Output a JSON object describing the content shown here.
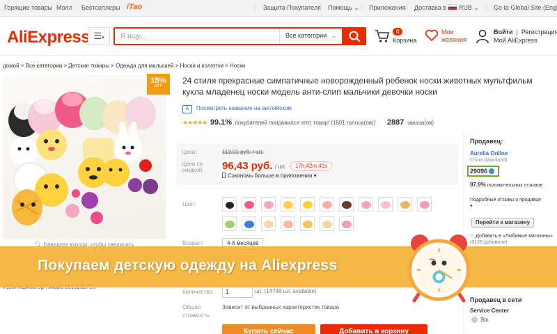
{
  "topbar": {
    "hot_deals": "Горящие товары",
    "mall": "Молл",
    "bestsellers": "Бестселлеры",
    "taobao": "iTao",
    "buyer_protection": "Защита Покупателя",
    "help": "Помощь",
    "apps": "Приложения",
    "ship_to": "Доставка в",
    "currency": "RUB",
    "global_site": "Go to Global Site (English)"
  },
  "header": {
    "logo": "AliExpress",
    "search_placeholder": "Я ищу...",
    "search_category": "Все категории",
    "cart_count": "0",
    "cart_label": "Корзина",
    "wishlist_label_1": "Мои",
    "wishlist_label_2": "желания",
    "login": "Войти",
    "register": "Регистрация",
    "my_aliexpress": "Мой AliExpress"
  },
  "breadcrumb": [
    "домой",
    "Все категории",
    "Детские товары",
    "Одежда для малышей",
    "Носки и колготки",
    "Носки"
  ],
  "product": {
    "discount_pct": "15%",
    "discount_off": "OFF",
    "zoom_hint": "Наведите курсор, чтобы увеличить",
    "title": "24 стиля прекрасные симпатичные новорожденный ребенок носки животных мультфильм кукла младенец носки модель анти-слип мальчики девочки носки",
    "translate_link": "Посмотреть название на английском",
    "rating_pct": "99.1%",
    "rating_text": "покупателей понравился этот товар! (1501 голоса(ов))",
    "orders_count": "2887",
    "orders_label": "заказа(ов)",
    "price_label": "Цена:",
    "old_price": "113,01 руб. / шт.",
    "discount_price_label_1": "Цена со",
    "discount_price_label_2": "скидкой:",
    "new_price": "96,43 руб.",
    "price_unit": "/ шт.",
    "timer": "17h:42m:41s",
    "app_save": "Сэкономь больше в приложении",
    "color_label": "Цвет:",
    "age_label": "Возраст",
    "age_value": "4-6 месяцев",
    "product_id": "Идентификатор товара 2013202735",
    "qty_label": "Количество:",
    "qty_value": "1",
    "qty_available": "шт. (14748 шт. available)",
    "total_label_1": "Общая",
    "total_label_2": "стоимость:",
    "total_note": "Зависит от выбранных характеристик товара",
    "buy_now": "Купить сейчас",
    "add_to_cart": "Добавить в корзину"
  },
  "seller": {
    "title": "Продавец:",
    "name": "Aurelia Online",
    "location": "China (Mainland)",
    "score": "29096",
    "feedback_pct": "97.9%",
    "feedback_label": "положительных отзывов",
    "detail_reviews": "Подробные отзывы о продавце",
    "go_to_store": "Перейти к магазину",
    "add_fav": "Добавить в «Любимые магазины»",
    "fav_count": "(5128 добавили)",
    "network_title": "Продавец в сети",
    "service_center": "Service Center",
    "six": "Six"
  },
  "banner": {
    "text": "Покупаем детскую одежду на Aliexpress"
  },
  "colors": {
    "brand_red": "#e62e04",
    "banner_orange": "#f6b53c",
    "score_green": "#6aae2a"
  }
}
